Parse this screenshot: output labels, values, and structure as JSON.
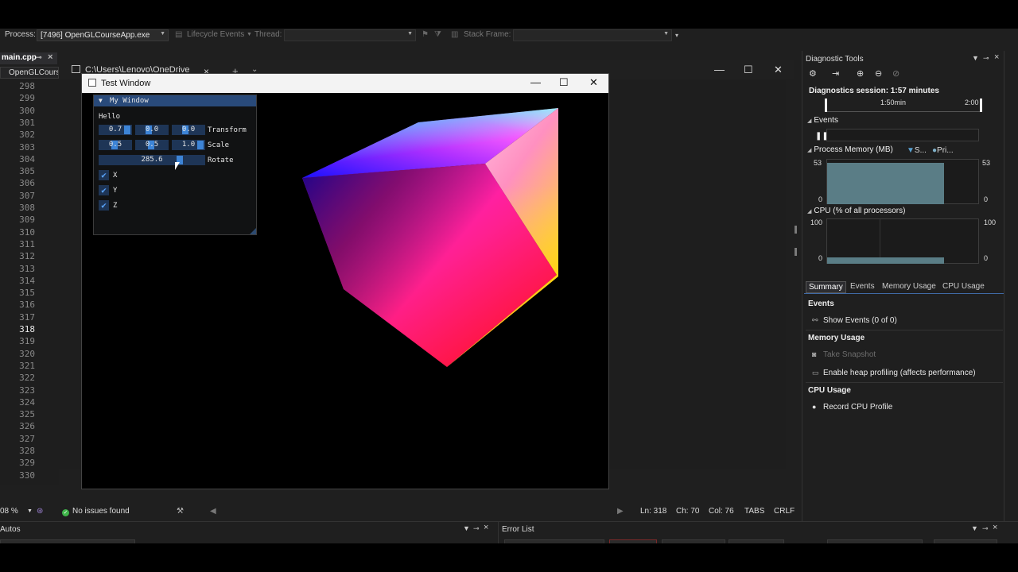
{
  "toolbar": {
    "process_label": "Process:",
    "process_value": "[7496] OpenGLCourseApp.exe",
    "lifecycle_label": "Lifecycle Events",
    "thread_label": "Thread:",
    "stack_frame_label": "Stack Frame:"
  },
  "editor": {
    "tab_label": "main.cpp",
    "nav_project": "OpenGLCourse",
    "line_numbers": [
      "298",
      "299",
      "300",
      "301",
      "302",
      "303",
      "304",
      "305",
      "306",
      "307",
      "308",
      "309",
      "310",
      "311",
      "312",
      "313",
      "314",
      "315",
      "316",
      "317",
      "318",
      "319",
      "320",
      "321",
      "322",
      "323",
      "324",
      "325",
      "326",
      "327",
      "328",
      "329",
      "330"
    ],
    "current_line": "318"
  },
  "console": {
    "tab_title": "C:\\Users\\Lenovo\\OneDrive"
  },
  "test_window": {
    "title": "Test Window"
  },
  "imgui": {
    "window_title": "My Window",
    "hello_text": "Hello",
    "transform_values": [
      "0.7",
      "0.0",
      "0.0"
    ],
    "transform_label": "Transform",
    "scale_values": [
      "0.5",
      "0.5",
      "1.0"
    ],
    "scale_label": "Scale",
    "rotate_value": "285.6",
    "rotate_label": "Rotate",
    "checkboxes": [
      {
        "label": "X",
        "checked": true
      },
      {
        "label": "Y",
        "checked": true
      },
      {
        "label": "Z",
        "checked": true
      }
    ],
    "accent_color": "#3d84d6"
  },
  "diagnostics": {
    "title": "Diagnostic Tools",
    "session": "Diagnostics session: 1:57 minutes",
    "timeline_labels": [
      "1:50min",
      "2:00"
    ],
    "events_label": "Events",
    "memory_label": "Process Memory (MB)",
    "memory_legend": [
      "S...",
      "Pri..."
    ],
    "memory_axis": {
      "max_left": "53",
      "min_left": "0",
      "max_right": "53",
      "min_right": "0"
    },
    "cpu_label": "CPU (% of all processors)",
    "cpu_axis": {
      "max_left": "100",
      "min_left": "0",
      "max_right": "100",
      "min_right": "0"
    },
    "tabs": [
      "Summary",
      "Events",
      "Memory Usage",
      "CPU Usage"
    ],
    "active_tab": "Summary",
    "events_header": "Events",
    "show_events": "Show Events (0 of 0)",
    "memory_header": "Memory Usage",
    "take_snapshot": "Take Snapshot",
    "heap_profiling": "Enable heap profiling (affects performance)",
    "cpu_header": "CPU Usage",
    "record_cpu": "Record CPU Profile",
    "graph_color": "#5a7d86"
  },
  "status_bar": {
    "zoom": "08 %",
    "issues": "No issues found",
    "line": "Ln: 318",
    "char": "Ch: 70",
    "col": "Col: 76",
    "indent": "TABS",
    "eol": "CRLF"
  },
  "bottom_panels": {
    "autos_title": "Autos",
    "error_list_title": "Error List"
  }
}
